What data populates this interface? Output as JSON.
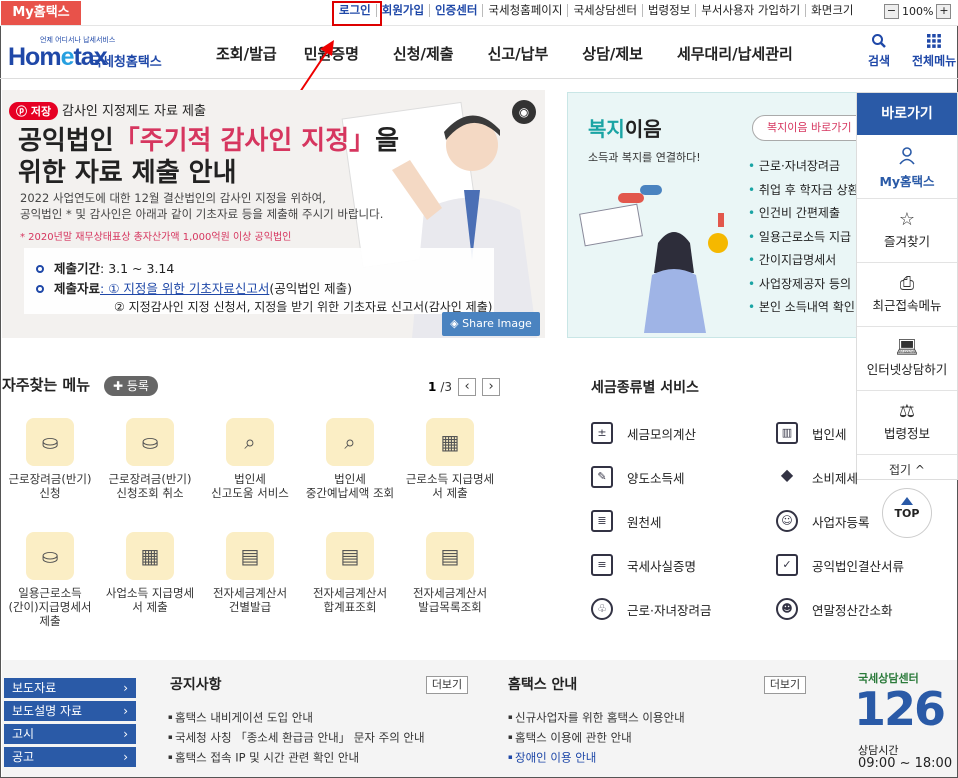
{
  "util": {
    "my_tab": "My홈택스",
    "links": [
      "로그인",
      "회원가입",
      "인증센터",
      "국세청홈페이지",
      "국세상담센터",
      "법령정보",
      "부서사용자 가입하기",
      "화면크기"
    ],
    "zoom_minus": "−",
    "zoom_level": "100%",
    "zoom_plus": "+"
  },
  "header": {
    "logo_small": "언제 어디서나 납세서비스",
    "logo_main_a": "Hom",
    "logo_main_e": "e",
    "logo_main_b": "tax",
    "logo_sub": "국세청홈택스",
    "nav": [
      "조회/발급",
      "민원증명",
      "신청/제출",
      "신고/납부",
      "상담/제보",
      "세무대리/납세관리"
    ],
    "search_label": "검색",
    "all_menu_label": "전체메뉴"
  },
  "banner": {
    "save_label": "저장",
    "subtitle": "감사인 지정제도 자료 제출",
    "title_line1_a": "공익법인",
    "title_line1_em": "「주기적 감사인 지정」",
    "title_line1_b": "을",
    "title_line2": "위한 자료 제출 안내",
    "para1": "2022 사업연도에 대한 12월 결산법인의 감사인 지정을 위하여,",
    "para2": "공익법인 * 및 감사인은 아래과 같이 기초자료 등을 제출해 주시기 바랍니다.",
    "note": "* 2020년말 재무상태표상 총자산가액 1,000억원 이상 공익법인",
    "period_label": "제출기간",
    "period_value": ": 3.1 ~ 3.14",
    "docs_label": "제출자료",
    "docs_value1_link": ": ① 지정을 위한 기초자료신고서",
    "docs_value1_rest": "(공익법인 제출)",
    "docs_value2": "② 지정감사인 지정 신청서, 지정을 받기 위한 기초자료 신고서(감사인 제출)",
    "share_label": "Share Image"
  },
  "welfare": {
    "title_em": "복지",
    "title_rest": "이음",
    "subtitle": "소득과 복지를 연결하다!",
    "button": "복지이음 바로가기",
    "items": [
      "근로·자녀장려금",
      "취업 후 학자금 상환",
      "인건비 간편제출",
      "일용근로소득 지급",
      "간이지급명세서",
      "사업장제공자 등의",
      "본인 소득내역 확인"
    ]
  },
  "quick": {
    "header": "바로가기",
    "items": [
      {
        "label": "My홈택스",
        "icon": "user-icon"
      },
      {
        "label": "즐겨찾기",
        "icon": "star-icon"
      },
      {
        "label": "최근접속메뉴",
        "icon": "recent-icon"
      },
      {
        "label": "인터넷상담하기",
        "icon": "laptop-icon"
      },
      {
        "label": "법령정보",
        "icon": "gavel-icon"
      }
    ],
    "fold": "접기 ^",
    "top": "TOP"
  },
  "favorites": {
    "title": "자주찾는 메뉴",
    "register": "등록",
    "page_current": "1",
    "page_total": "/3",
    "items": [
      {
        "l1": "근로장려금(반기)",
        "l2": "신청",
        "l3": ""
      },
      {
        "l1": "근로장려금(반기)",
        "l2": "신청조회 취소",
        "l3": ""
      },
      {
        "l1": "법인세",
        "l2": "신고도움 서비스",
        "l3": ""
      },
      {
        "l1": "법인세",
        "l2": "중간예납세액 조회",
        "l3": ""
      },
      {
        "l1": "근로소득 지급명세",
        "l2": "서 제출",
        "l3": ""
      },
      {
        "l1": "일용근로소득",
        "l2": "(간이)지급명세서",
        "l3": "제출"
      },
      {
        "l1": "사업소득 지급명세",
        "l2": "서 제출",
        "l3": ""
      },
      {
        "l1": "전자세금계산서",
        "l2": "건별발급",
        "l3": ""
      },
      {
        "l1": "전자세금계산서",
        "l2": "합계표조회",
        "l3": ""
      },
      {
        "l1": "전자세금계산서",
        "l2": "발급목록조회",
        "l3": ""
      }
    ]
  },
  "tax_types": {
    "title": "세금종류별 서비스",
    "left": [
      "세금모의계산",
      "양도소득세",
      "원천세",
      "국세사실증명",
      "근로·자녀장려금"
    ],
    "right": [
      "법인세",
      "소비제세",
      "사업자등록",
      "공익법인결산서류",
      "연말정산간소화"
    ]
  },
  "footer": {
    "side": [
      "보도자료",
      "보도설명 자료",
      "고시",
      "공고"
    ],
    "notice_title": "공지사항",
    "notice_more": "더보기",
    "notices": [
      "홈택스 내비게이션 도입 안내",
      "국세청 사칭 「종소세 환급금 안내」 문자 주의 안내",
      "홈택스 접속 IP 및 시간 관련 확인 안내"
    ],
    "guide_title": "홈택스 안내",
    "guide_more": "더보기",
    "guides": [
      "신규사업자를 위한 홈택스 이용안내",
      "홈택스 이용에 관한 안내",
      "장애인 이용 안내"
    ],
    "cs_top": "국세상담센터",
    "cs_number": "126",
    "cs_time_label": "상담시간",
    "cs_hours": "09:00 ~ 18:00"
  }
}
